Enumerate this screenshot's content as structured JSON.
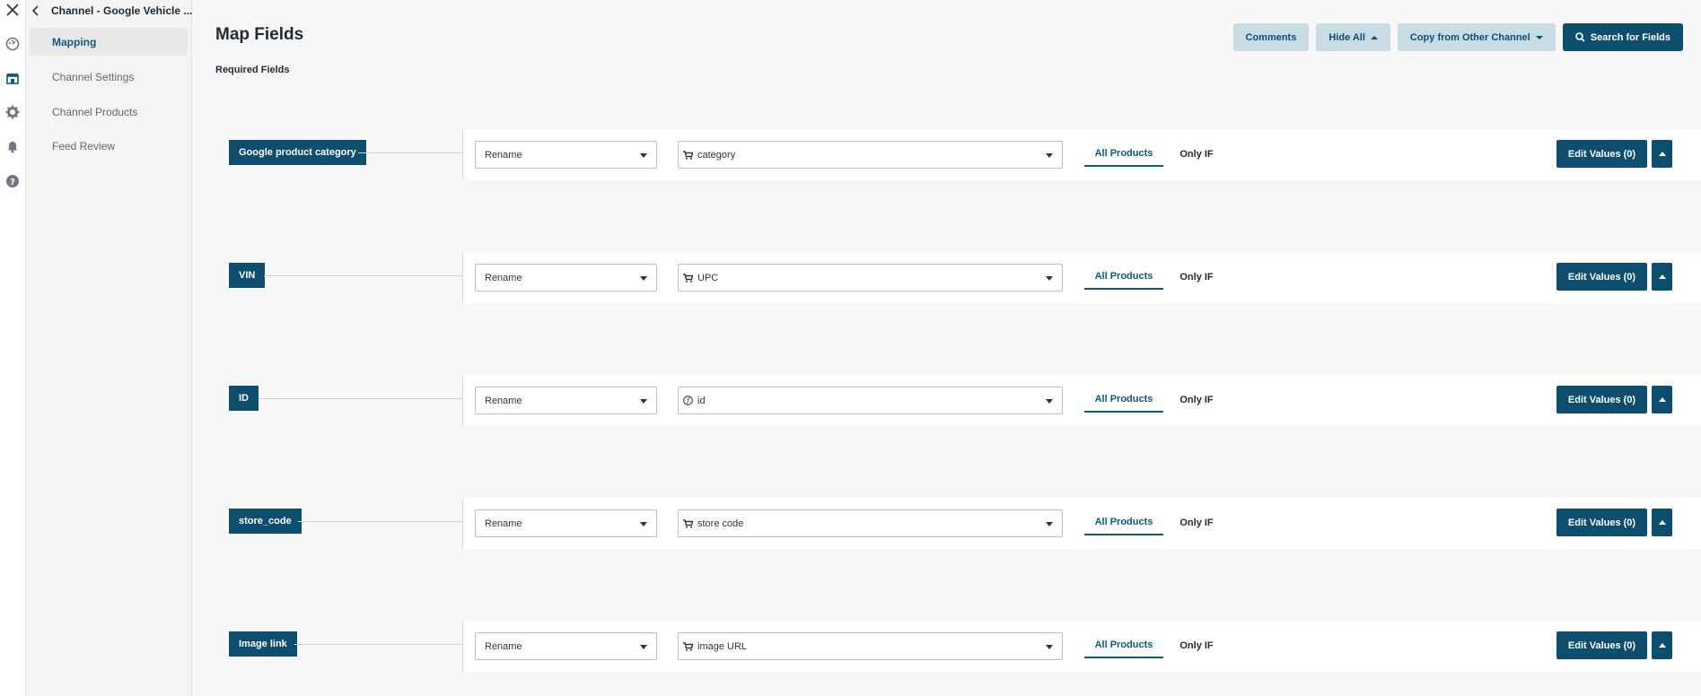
{
  "nav": {
    "back_title": "Channel - Google Vehicle ...",
    "items": [
      {
        "label": "Mapping",
        "active": true
      },
      {
        "label": "Channel Settings",
        "active": false
      },
      {
        "label": "Channel Products",
        "active": false
      },
      {
        "label": "Feed Review",
        "active": false
      }
    ]
  },
  "rail_icons": [
    "close-icon",
    "dashboard-icon",
    "store-icon",
    "gear-icon",
    "bell-icon",
    "help-icon"
  ],
  "header": {
    "title": "Map Fields",
    "section": "Required Fields",
    "buttons": {
      "comments": "Comments",
      "hide_all": "Hide All",
      "copy": "Copy from Other Channel",
      "search": "Search for Fields"
    }
  },
  "rows": [
    {
      "field": "Google product category",
      "action": "Rename",
      "source": "category",
      "source_icon": "cart-icon",
      "tab_all": "All Products",
      "tab_only": "Only IF",
      "edit": "Edit Values (0)"
    },
    {
      "field": "VIN",
      "action": "Rename",
      "source": "UPC",
      "source_icon": "cart-icon",
      "tab_all": "All Products",
      "tab_only": "Only IF",
      "edit": "Edit Values (0)"
    },
    {
      "field": "ID",
      "action": "Rename",
      "source": "id",
      "source_icon": "function-icon",
      "tab_all": "All Products",
      "tab_only": "Only IF",
      "edit": "Edit Values (0)"
    },
    {
      "field": "store_code",
      "action": "Rename",
      "source": "store code",
      "source_icon": "cart-icon",
      "tab_all": "All Products",
      "tab_only": "Only IF",
      "edit": "Edit Values (0)"
    },
    {
      "field": "Image link",
      "action": "Rename",
      "source": "image URL",
      "source_icon": "cart-icon",
      "tab_all": "All Products",
      "tab_only": "Only IF",
      "edit": "Edit Values (0)"
    }
  ],
  "colors": {
    "accent": "#0d4e6e",
    "secondary_button": "#c9dce6"
  }
}
